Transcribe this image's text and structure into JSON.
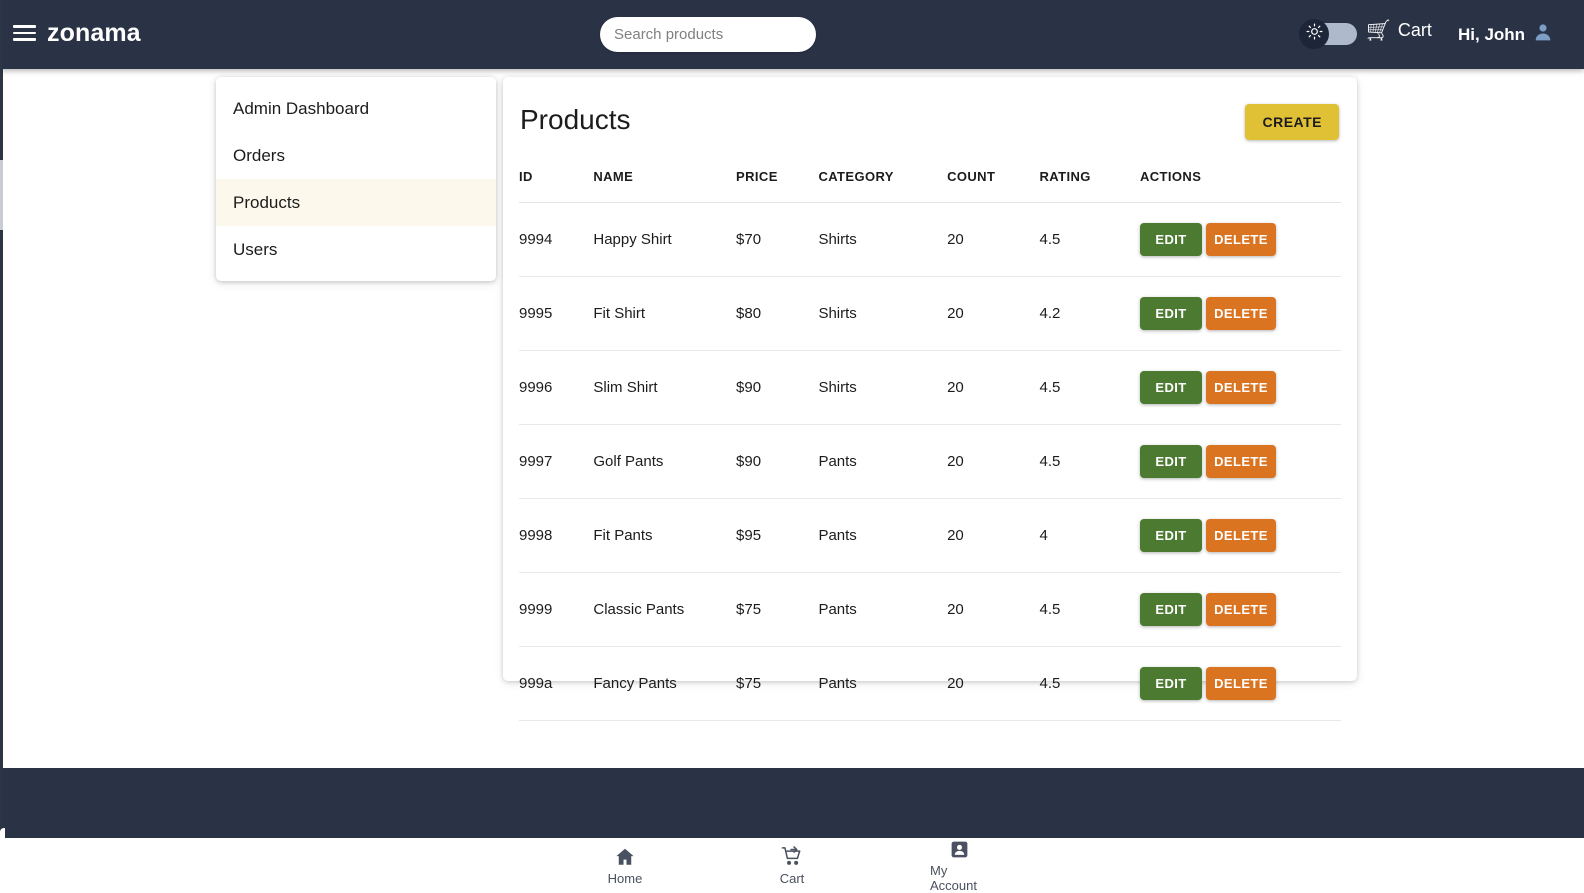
{
  "header": {
    "brand": "zonama",
    "menu_icon": "hamburger-icon",
    "search": {
      "placeholder": "Search products",
      "value": "",
      "button_icon": "search-icon"
    },
    "theme_toggle": {
      "icon": "sun-icon",
      "state": "off"
    },
    "cart": {
      "icon": "cart-icon",
      "label": "Cart"
    },
    "user": {
      "greeting": "Hi, John",
      "avatar_icon": "user-avatar-icon"
    }
  },
  "sidebar": {
    "items": [
      {
        "label": "Admin Dashboard",
        "active": false
      },
      {
        "label": "Orders",
        "active": false
      },
      {
        "label": "Products",
        "active": true
      },
      {
        "label": "Users",
        "active": false
      }
    ]
  },
  "main": {
    "title": "Products",
    "create_label": "CREATE",
    "table": {
      "columns": [
        "ID",
        "NAME",
        "PRICE",
        "CATEGORY",
        "COUNT",
        "RATING",
        "ACTIONS"
      ],
      "edit_label": "EDIT",
      "delete_label": "DELETE",
      "rows": [
        {
          "id": "9994",
          "name": "Happy Shirt",
          "price": "$70",
          "category": "Shirts",
          "count": "20",
          "rating": "4.5"
        },
        {
          "id": "9995",
          "name": "Fit Shirt",
          "price": "$80",
          "category": "Shirts",
          "count": "20",
          "rating": "4.2"
        },
        {
          "id": "9996",
          "name": "Slim Shirt",
          "price": "$90",
          "category": "Shirts",
          "count": "20",
          "rating": "4.5"
        },
        {
          "id": "9997",
          "name": "Golf Pants",
          "price": "$90",
          "category": "Pants",
          "count": "20",
          "rating": "4.5"
        },
        {
          "id": "9998",
          "name": "Fit Pants",
          "price": "$95",
          "category": "Pants",
          "count": "20",
          "rating": "4"
        },
        {
          "id": "9999",
          "name": "Classic Pants",
          "price": "$75",
          "category": "Pants",
          "count": "20",
          "rating": "4.5"
        },
        {
          "id": "999a",
          "name": "Fancy Pants",
          "price": "$75",
          "category": "Pants",
          "count": "20",
          "rating": "4.5"
        }
      ]
    }
  },
  "bottom_nav": {
    "items": [
      {
        "label": "Home",
        "icon": "home-icon"
      },
      {
        "label": "Cart",
        "icon": "add-to-cart-icon"
      },
      {
        "label": "My Account",
        "icon": "account-badge-icon"
      }
    ]
  },
  "colors": {
    "header_bg": "#2a3245",
    "accent_gold": "#e0c135",
    "edit_green": "#4d7a31",
    "delete_orange": "#db7421",
    "active_item_bg": "#fdf8ec"
  }
}
